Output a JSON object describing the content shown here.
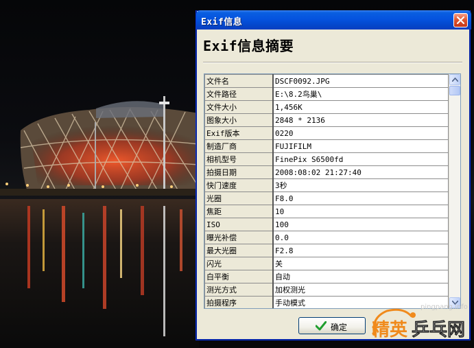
{
  "window": {
    "title": "Exif信息",
    "heading": "Exif信息摘要",
    "ok_label": "确定"
  },
  "exif_rows": [
    {
      "key": "文件名",
      "value": "DSCF0092.JPG"
    },
    {
      "key": "文件路径",
      "value": "E:\\8.2鸟巢\\"
    },
    {
      "key": "文件大小",
      "value": "1,456K"
    },
    {
      "key": "图象大小",
      "value": "2848 * 2136"
    },
    {
      "key": "Exif版本",
      "value": "0220"
    },
    {
      "key": "制造厂商",
      "value": "FUJIFILM"
    },
    {
      "key": "相机型号",
      "value": "FinePix S6500fd"
    },
    {
      "key": "拍摄日期",
      "value": "2008:08:02 21:27:40"
    },
    {
      "key": "快门速度",
      "value": "3秒"
    },
    {
      "key": "光圈",
      "value": "F8.0"
    },
    {
      "key": "焦距",
      "value": "10"
    },
    {
      "key": "ISO",
      "value": "100"
    },
    {
      "key": "曝光补偿",
      "value": "0.0"
    },
    {
      "key": "最大光圈",
      "value": "F2.8"
    },
    {
      "key": "闪光",
      "value": "关"
    },
    {
      "key": "白平衡",
      "value": "自动"
    },
    {
      "key": "测光方式",
      "value": "加权测光"
    },
    {
      "key": "拍摄程序",
      "value": "手动模式"
    }
  ],
  "watermark": {
    "url": "pingpang.info",
    "logo_text_1": "精英",
    "logo_text_2": "乒乓网"
  },
  "colors": {
    "titlebar": "#0553df",
    "dialog_bg": "#ece9d8",
    "close_button": "#e0562f",
    "logo_orange": "#f08a1c"
  }
}
